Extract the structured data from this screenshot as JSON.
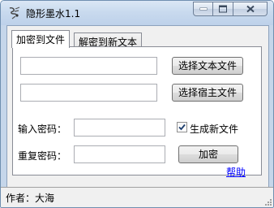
{
  "window": {
    "title": "隐形墨水1.1",
    "icon": "ink-brush-icon"
  },
  "caption_buttons": {
    "minimize_icon": "minimize-icon",
    "maximize_icon": "maximize-icon",
    "close_icon": "close-icon"
  },
  "tabs": [
    {
      "label": "加密到文件",
      "active": true
    },
    {
      "label": "解密到新文本",
      "active": false
    }
  ],
  "form": {
    "text_file_value": "",
    "host_file_value": "",
    "select_text_file_button": "选择文本文件",
    "select_host_file_button": "选择宿主文件",
    "password_label": "输入密码：",
    "password_value": "",
    "confirm_label": "重复密码：",
    "confirm_value": "",
    "generate_new_file_label": "生成新文件",
    "generate_new_file_checked": true,
    "encrypt_button": "加密",
    "help_link": "帮助"
  },
  "statusbar": {
    "text": "作者：大海"
  },
  "colors": {
    "title_bar": "#c9daee",
    "panel": "#f0f0f0",
    "link": "#0000ff"
  }
}
